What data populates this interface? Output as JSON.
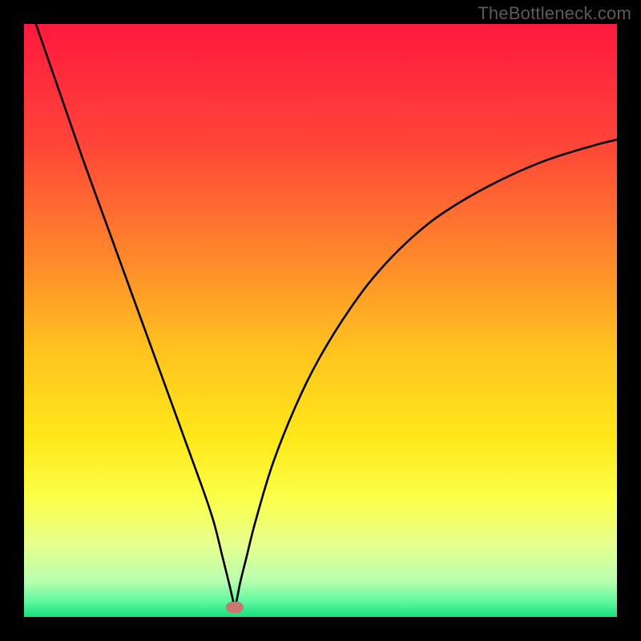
{
  "watermark": "TheBottleneck.com",
  "chart_data": {
    "type": "line",
    "title": "",
    "xlabel": "",
    "ylabel": "",
    "xlim": [
      0,
      100
    ],
    "ylim": [
      0,
      100
    ],
    "grid": false,
    "legend": false,
    "gradient_stops": [
      {
        "offset": 0.0,
        "color": "#ff1a3e"
      },
      {
        "offset": 0.2,
        "color": "#ff4438"
      },
      {
        "offset": 0.4,
        "color": "#ff8a2b"
      },
      {
        "offset": 0.55,
        "color": "#ffc31f"
      },
      {
        "offset": 0.7,
        "color": "#ffe81a"
      },
      {
        "offset": 0.8,
        "color": "#fbff4a"
      },
      {
        "offset": 0.88,
        "color": "#e6ff8f"
      },
      {
        "offset": 0.94,
        "color": "#b6ffb0"
      },
      {
        "offset": 0.975,
        "color": "#5cf79e"
      },
      {
        "offset": 1.0,
        "color": "#16e07e"
      }
    ],
    "series": [
      {
        "name": "bottleneck-curve",
        "color": "#000000",
        "x": [
          2.0,
          6,
          10,
          14,
          18,
          22,
          26,
          30,
          32,
          33.5,
          34.5,
          35.2,
          35.5,
          35.9,
          36.5,
          37.5,
          39,
          42,
          46,
          50,
          55,
          60,
          66,
          72,
          80,
          88,
          96,
          100
        ],
        "values": [
          100,
          88.5,
          77,
          66,
          55,
          44,
          33,
          22,
          16,
          10,
          6,
          3,
          1.6,
          3,
          6,
          10,
          16,
          26,
          36,
          44,
          52,
          58.5,
          64.5,
          69,
          73.5,
          77,
          79.5,
          80.5
        ]
      }
    ],
    "marker": {
      "x": 35.5,
      "y": 1.6,
      "color": "#c8786f"
    }
  }
}
